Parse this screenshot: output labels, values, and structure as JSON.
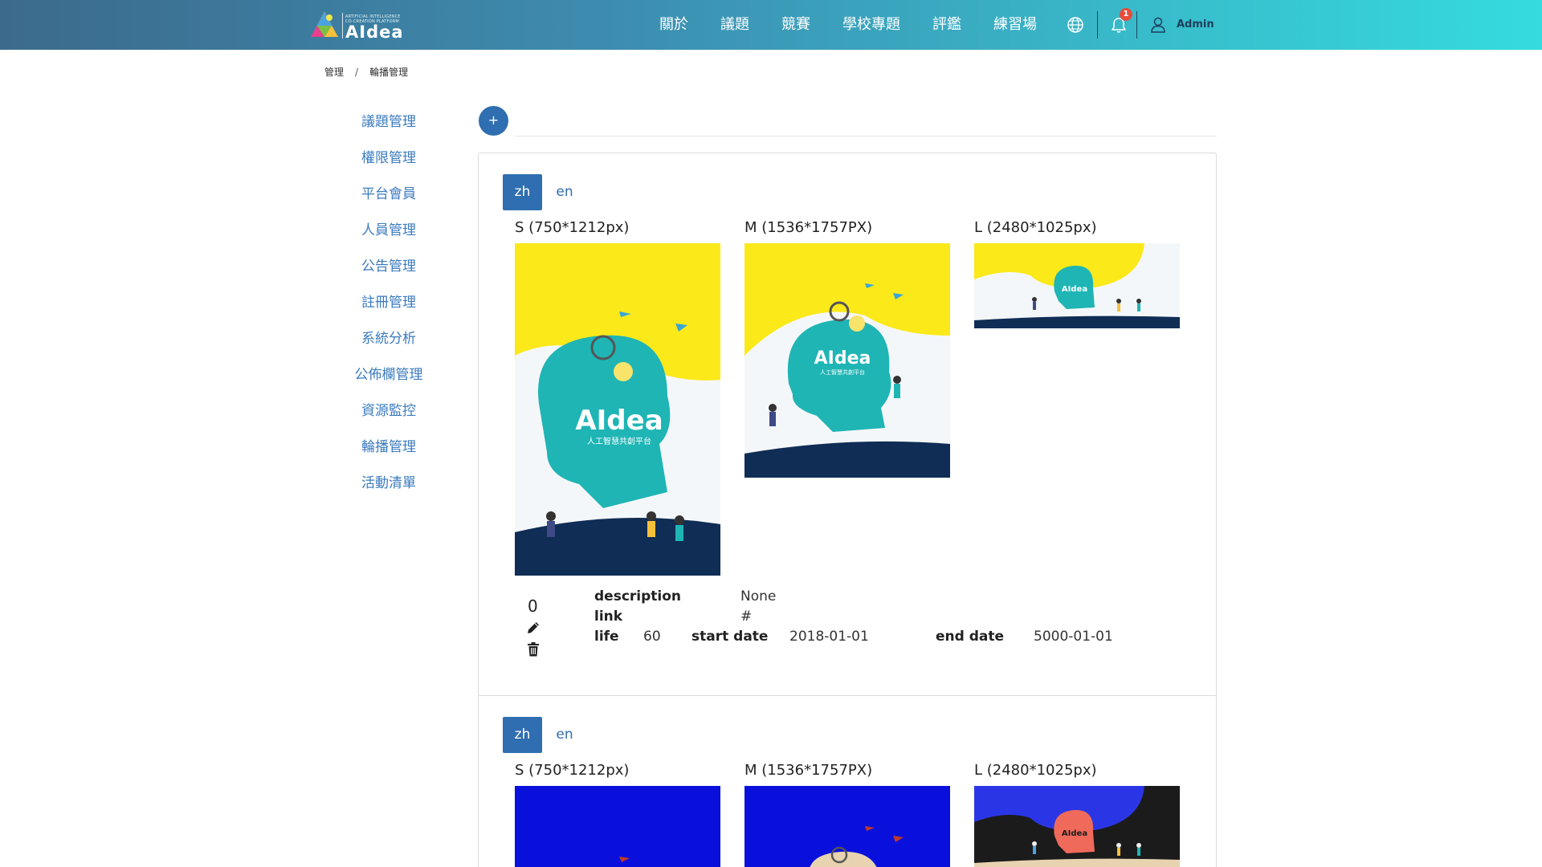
{
  "nav": {
    "brand": "AIdea",
    "brand_tagline_1": "ARTIFICIAL INTELLIGENCE",
    "brand_tagline_2": "CO-CREATION PLATFORM",
    "links": [
      "關於",
      "議題",
      "競賽",
      "學校專題",
      "評鑑",
      "練習場"
    ],
    "language_icon": "globe-icon",
    "notification_icon": "bell-icon",
    "notification_count": "1",
    "user_icon": "user-icon",
    "user_name": "Admin"
  },
  "breadcrumb": {
    "root": "管理",
    "separator": "/",
    "current": "輪播管理"
  },
  "sidebar": {
    "items": [
      "議題管理",
      "權限管理",
      "平台會員",
      "人員管理",
      "公告管理",
      "註冊管理",
      "系統分析",
      "公佈欄管理",
      "資源監控",
      "輪播管理",
      "活動清單"
    ]
  },
  "toolbar": {
    "add_label": "+"
  },
  "carousel": {
    "items": [
      {
        "tabs": [
          "zh",
          "en"
        ],
        "active_tab": "zh",
        "sizes": {
          "s": "S (750*1212px)",
          "m": "M (1536*1757PX)",
          "l": "L (2480*1025px)"
        },
        "theme": "yellow",
        "image_title": "AIdea",
        "image_subtitle": "人工智慧共創平台",
        "order": "0",
        "description_label": "description",
        "description": "None",
        "link_label": "link",
        "link": "#",
        "life_label": "life",
        "life": "60",
        "start_label": "start date",
        "start_date": "2018-01-01",
        "end_label": "end date",
        "end_date": "5000-01-01"
      },
      {
        "tabs": [
          "zh",
          "en"
        ],
        "active_tab": "zh",
        "sizes": {
          "s": "S (750*1212px)",
          "m": "M (1536*1757PX)",
          "l": "L (2480*1025px)"
        },
        "theme": "blue",
        "image_title": "AIdea"
      }
    ]
  },
  "colors": {
    "nav_gradient_start": "#3c6a8c",
    "nav_gradient_end": "#35dbdf",
    "primary": "#2f6eb0",
    "link": "#3b7bbf",
    "badge": "#e74c3c",
    "banner_yellow": "#fbe91a",
    "banner_teal": "#1fb5b5",
    "banner_blue": "#0a10dc",
    "banner_navy": "#0f2d55"
  }
}
